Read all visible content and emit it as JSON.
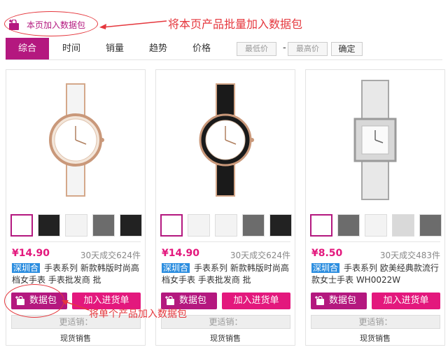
{
  "top": {
    "page_add_label": "本页加入数据包",
    "annotation_batch": "将本页产品批量加入数据包",
    "annotation_single": "将单个产品加入数据包"
  },
  "sort": {
    "tabs": [
      {
        "label": "综合",
        "active": true
      },
      {
        "label": "时间",
        "active": false
      },
      {
        "label": "销量",
        "active": false
      },
      {
        "label": "趋势",
        "active": false
      },
      {
        "label": "价格",
        "active": false
      }
    ],
    "min_price_placeholder": "最低价",
    "dash": "-",
    "max_price_placeholder": "最高价",
    "confirm_label": "确定"
  },
  "colors": {
    "brand": "#b4187f",
    "price": "#e3187d",
    "tag": "#2e8fe0",
    "annotation": "#e5373d"
  },
  "products": [
    {
      "price": "¥14.90",
      "sold": "30天成交624件",
      "tag": "深圳合",
      "title": "手表系列 新款韩版时尚高档女手表 手表批发商 批",
      "pack_label": "数据包",
      "cart_label": "加入进货单",
      "more_label": "更适销：",
      "stock_label": "现货销售",
      "watch_style": "white"
    },
    {
      "price": "¥14.90",
      "sold": "30天成交624件",
      "tag": "深圳合",
      "title": "手表系列 新款韩版时尚高档女手表 手表批发商 批",
      "pack_label": "数据包",
      "cart_label": "加入进货单",
      "more_label": "更适销：",
      "stock_label": "现货销售",
      "watch_style": "black"
    },
    {
      "price": "¥8.50",
      "sold": "30天成交483件",
      "tag": "深圳合",
      "title": "手表系列 欧美经典款流行款女士手表 WH0022W",
      "pack_label": "数据包",
      "cart_label": "加入进货单",
      "more_label": "更适销：",
      "stock_label": "现货销售",
      "watch_style": "silver"
    }
  ]
}
